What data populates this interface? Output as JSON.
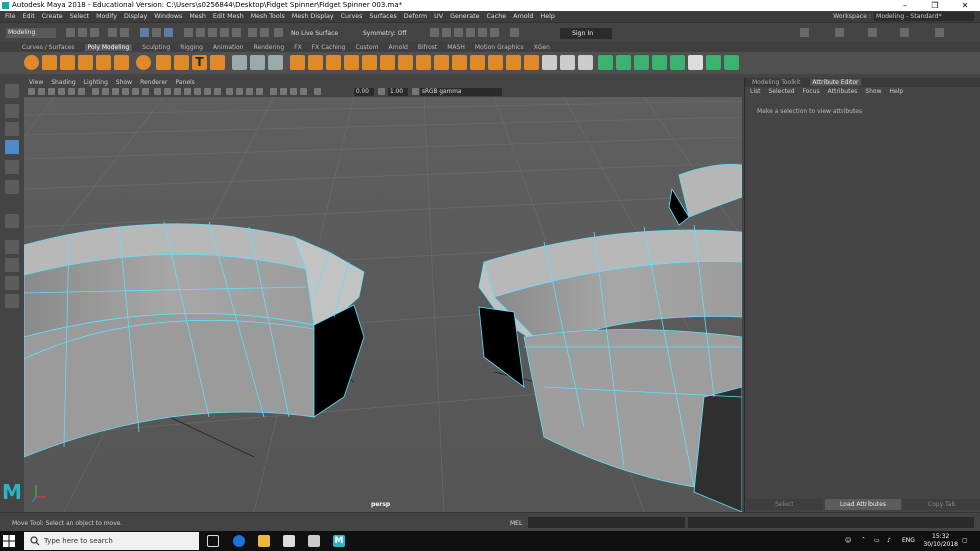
{
  "titlebar": {
    "title": "Autodesk Maya 2018 - Educational Version: C:\\Users\\s0256844\\Desktop\\Fidget Spinner\\Fidget Spinner 003.ma*",
    "minimize": "–",
    "maximize": "❐",
    "close": "✕"
  },
  "menubar": {
    "items": [
      "File",
      "Edit",
      "Create",
      "Select",
      "Modify",
      "Display",
      "Windows",
      "Mesh",
      "Edit Mesh",
      "Mesh Tools",
      "Mesh Display",
      "Curves",
      "Surfaces",
      "Deform",
      "UV",
      "Generate",
      "Cache",
      "Arnold",
      "Help"
    ]
  },
  "workspace": {
    "label": "Workspace :",
    "value": "Modeling - Standard*"
  },
  "statusline": {
    "mode": "Modeling",
    "live_surface": "No Live Surface",
    "symmetry": "Symmetry: Off",
    "signin": "Sign In"
  },
  "shelf_tabs": [
    "Curves / Surfaces",
    "Poly Modeling",
    "Sculpting",
    "Rigging",
    "Animation",
    "Rendering",
    "FX",
    "FX Caching",
    "Custom",
    "Arnold",
    "Bifrost",
    "MASH",
    "Motion Graphics",
    "XGen"
  ],
  "shelf_active": "Poly Modeling",
  "viewport": {
    "menu": [
      "View",
      "Shading",
      "Lighting",
      "Show",
      "Renderer",
      "Panels"
    ],
    "field_a": "0.00",
    "field_b": "1.00",
    "colorspace": "sRGB gamma",
    "camera_label": "persp"
  },
  "panel": {
    "tabs": [
      "Modeling Toolkit",
      "Attribute Editor"
    ],
    "active_tab": "Attribute Editor",
    "menu": [
      "List",
      "Selected",
      "Focus",
      "Attributes",
      "Show",
      "Help"
    ],
    "message": "Make a selection to view attributes",
    "buttons": [
      "Select",
      "Load Attributes",
      "Copy Tab"
    ]
  },
  "helpline": {
    "text": "Move Tool: Select an object to move.",
    "mel": "MEL"
  },
  "taskbar": {
    "search": "Type here to search",
    "lang": "ENG",
    "time": "15:32",
    "date": "30/10/2018"
  },
  "colors": {
    "accent": "#2cb5c3",
    "wire": "#5ee0ff",
    "shelf_orange": "#e0892a",
    "shelf_green": "#3bb26e"
  }
}
